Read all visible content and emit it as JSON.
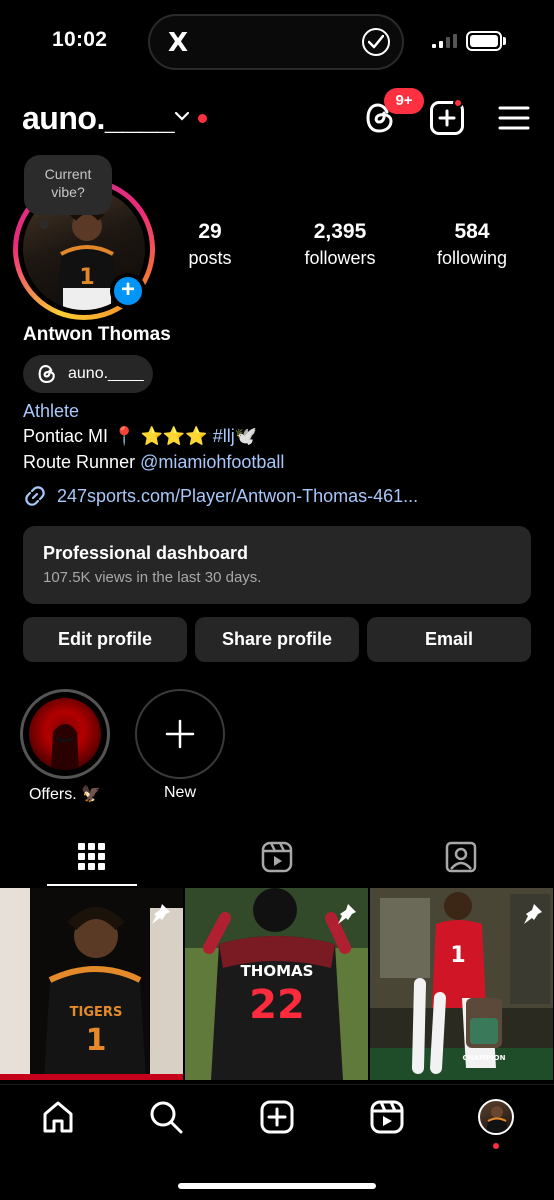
{
  "status_bar": {
    "time": "10:02",
    "island_app": "X"
  },
  "header": {
    "username": "auno.____",
    "notification_count": "9+"
  },
  "profile": {
    "vibe_prompt_line1": "Current",
    "vibe_prompt_line2": "vibe?",
    "stats": [
      {
        "value": "29",
        "label": "posts"
      },
      {
        "value": "2,395",
        "label": "followers"
      },
      {
        "value": "584",
        "label": "following"
      }
    ],
    "full_name": "Antwon Thomas",
    "threads_handle": "auno.____",
    "category": "Athlete",
    "bio_line1_text": "Pontiac  MI",
    "bio_line1_emoji": "📍 ⭐⭐⭐",
    "bio_line1_hashtag": "#llj",
    "bio_line1_emoji2": "🕊️",
    "bio_line2_text": "Route Runner ",
    "bio_line2_mention": "@miamiohfootball",
    "link": "247sports.com/Player/Antwon-Thomas-461..."
  },
  "dashboard": {
    "title": "Professional dashboard",
    "subtitle": "107.5K views in the last 30 days."
  },
  "actions": {
    "edit": "Edit profile",
    "share": "Share profile",
    "email": "Email"
  },
  "highlights": [
    {
      "label": "Offers. 🦅"
    },
    {
      "label": "New"
    }
  ],
  "tabs": [
    "grid-icon",
    "reels-icon",
    "tagged-icon"
  ],
  "grid": [
    {
      "jersey_text": "TIGERS",
      "jersey_number": "1"
    },
    {
      "jersey_text": "THOMAS",
      "jersey_number": "22"
    },
    {
      "jersey_text": "CHAMPION",
      "jersey_number": "1"
    }
  ],
  "colors": {
    "accent_blue": "#0095f6",
    "link_blue": "#a8c7fa",
    "badge_red": "#ff3040",
    "surface": "#262626"
  }
}
